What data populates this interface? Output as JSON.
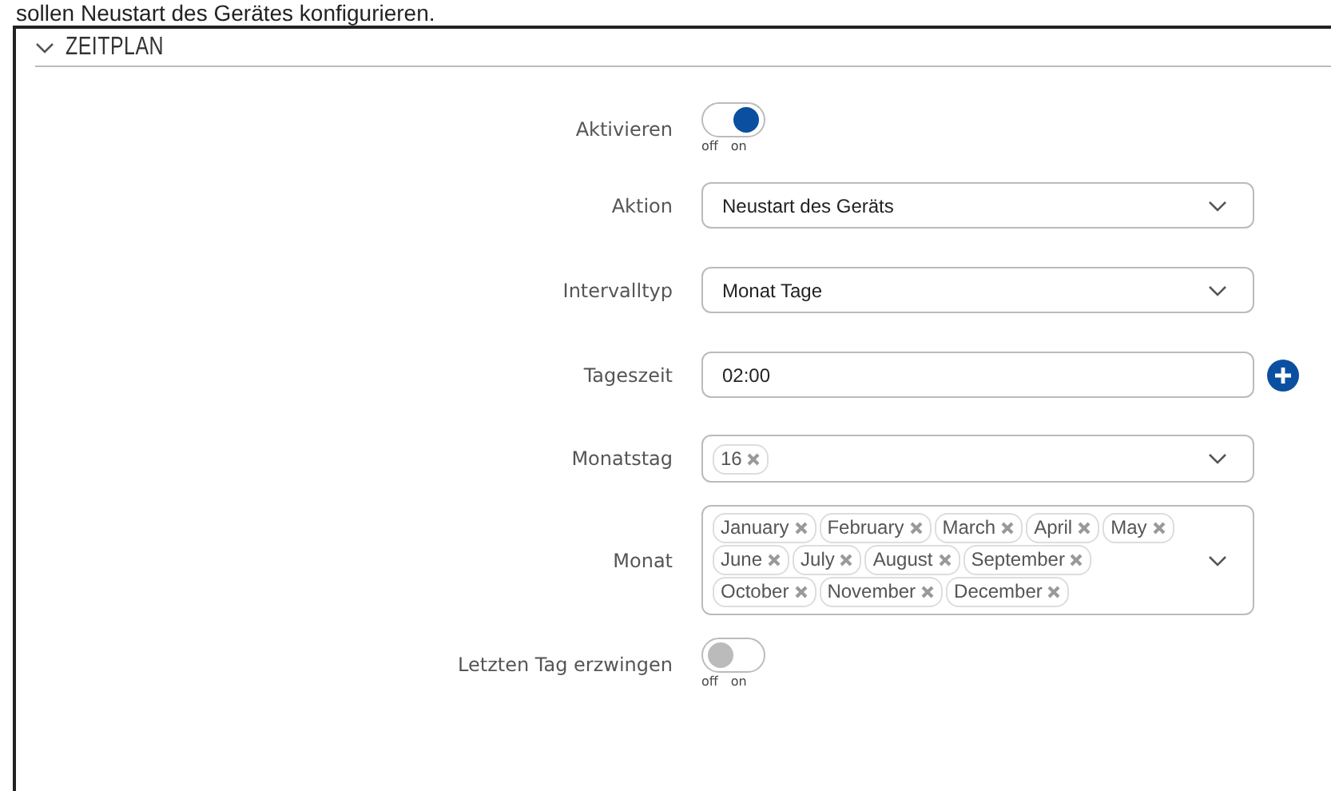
{
  "intro_text": "sollen Neustart des Gerätes konfigurieren.",
  "section": {
    "title": "ZEITPLAN",
    "expanded": true
  },
  "fields": [
    {
      "kind": "toggle",
      "label": "Aktivieren",
      "on": true,
      "off_label": "off",
      "on_label": "on"
    },
    {
      "kind": "select",
      "label": "Aktion",
      "value": "Neustart des Geräts"
    },
    {
      "kind": "select",
      "label": "Intervalltyp",
      "value": "Monat Tage"
    },
    {
      "kind": "text",
      "label": "Tageszeit",
      "value": "02:00",
      "add_button": true
    },
    {
      "kind": "tags",
      "label": "Monatstag",
      "tags": [
        "16"
      ]
    },
    {
      "kind": "tags",
      "label": "Monat",
      "tags": [
        "January",
        "February",
        "March",
        "April",
        "May",
        "June",
        "July",
        "August",
        "September",
        "October",
        "November",
        "December"
      ]
    },
    {
      "kind": "toggle",
      "label": "Letzten Tag erzwingen",
      "on": false,
      "off_label": "off",
      "on_label": "on"
    }
  ]
}
